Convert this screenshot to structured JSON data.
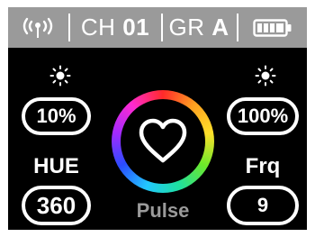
{
  "status_bar": {
    "signal_icon": "signal-icon",
    "channel_label": "CH",
    "channel_value": "01",
    "group_label": "GR",
    "group_value": "A",
    "battery_icon": "battery-icon",
    "battery_level": 1.0
  },
  "left_panel": {
    "brightness_icon": "sun-icon",
    "brightness_value": "10%",
    "param_label": "HUE",
    "param_value": "360"
  },
  "right_panel": {
    "brightness_icon": "sun-icon",
    "brightness_value": "100%",
    "param_label": "Frq",
    "param_value": "9"
  },
  "center": {
    "mode_icon": "heart-icon",
    "mode_label": "Pulse"
  },
  "colors": {
    "background": "#000000",
    "status_bar": "#9a9a9a",
    "foreground": "#ffffff",
    "mode_label": "#9a9a9a"
  }
}
